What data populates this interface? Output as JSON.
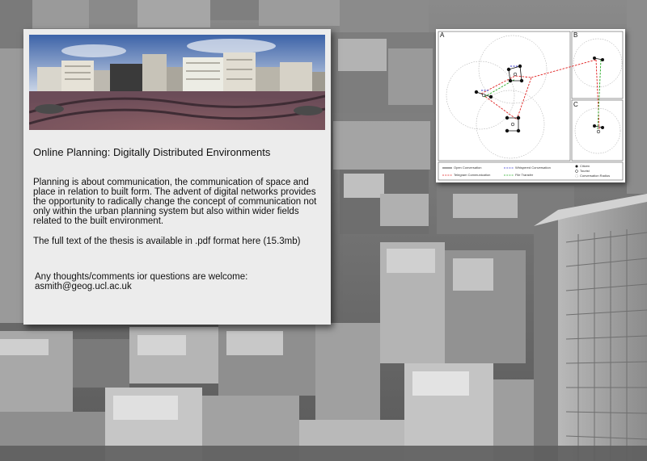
{
  "panel": {
    "title": "Online Planning: Digitally Distributed Environments",
    "body": "Planning is about communication, the communication of space and place in relation to built form. The advent of digital networks provides the opportunity to radically change the concept of communication not only within the urban planning system but also within wider fields related to the built environment.",
    "full_text": "The full text of the thesis is available in .pdf format here (15.3mb)",
    "contact_line": "Any thoughts/comments ior questions are welcome:",
    "email": "asmith@geog.ucl.ac.uk"
  },
  "diagram": {
    "panel_labels": [
      "A",
      "B",
      "C"
    ],
    "legend": {
      "open_conversation": "Open Conversation",
      "whispered_conversation": "Whispered Conversation",
      "telegram_communication": "Telegram Communication",
      "file_transfer": "File Transfer",
      "citizen": "Citizen",
      "tourist": "Tourist",
      "conversation_radius": "Conversation Radius"
    },
    "colors": {
      "open": "#111111",
      "whispered": "#3333cc",
      "telegram": "#e02020",
      "file": "#22aa22"
    }
  }
}
